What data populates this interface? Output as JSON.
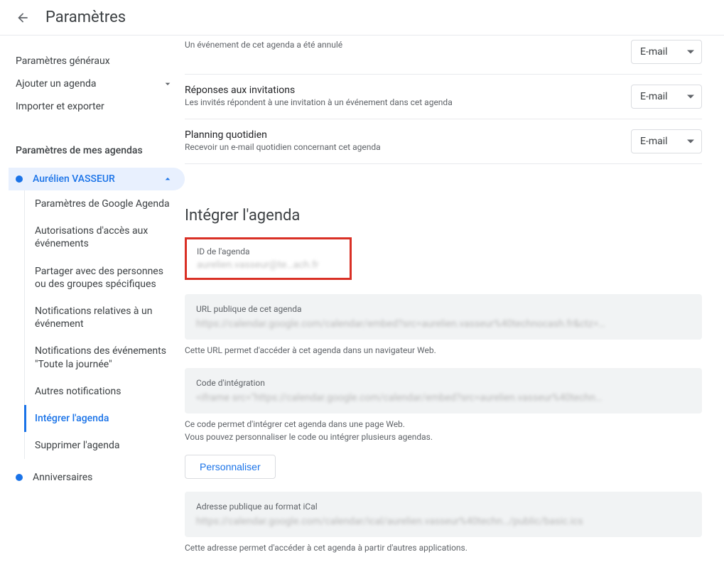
{
  "header": {
    "title": "Paramètres"
  },
  "sidebar": {
    "generalItems": [
      {
        "label": "Paramètres généraux",
        "expandable": false
      },
      {
        "label": "Ajouter un agenda",
        "expandable": true
      },
      {
        "label": "Importer et exporter",
        "expandable": false
      }
    ],
    "myCalsHeader": "Paramètres de mes agendas",
    "activeCalendar": {
      "name": "Aurélien VASSEUR",
      "color": "#1a73e8"
    },
    "subitems": [
      "Paramètres de Google Agenda",
      "Autorisations d'accès aux événements",
      "Partager avec des personnes ou des groupes spécifiques",
      "Notifications relatives à un événement",
      "Notifications des événements \"Toute la journée\"",
      "Autres notifications",
      "Intégrer l'agenda",
      "Supprimer l'agenda"
    ],
    "activeSubIndex": 6,
    "otherCalendar": {
      "name": "Anniversaires",
      "color": "#1a73e8"
    }
  },
  "notifications": {
    "cancelled": {
      "desc": "Un événement de cet agenda a été annulé",
      "value": "E-mail"
    },
    "inviteReplies": {
      "title": "Réponses aux invitations",
      "desc": "Les invités répondent à une invitation à un événement dans cet agenda",
      "value": "E-mail"
    },
    "daily": {
      "title": "Planning quotidien",
      "desc": "Recevoir un e-mail quotidien concernant cet agenda",
      "value": "E-mail"
    }
  },
  "integrate": {
    "sectionTitle": "Intégrer l'agenda",
    "calendarId": {
      "label": "ID de l'agenda",
      "value": "aurelien.vasseur@te…ach.fr"
    },
    "publicUrl": {
      "label": "URL publique de cet agenda",
      "value": "https://calendar.google.com/calendar/embed?src=aurelien.vasseur%40technocash.fr&ctz=…",
      "helper": "Cette URL permet d'accéder à cet agenda dans un navigateur Web."
    },
    "embedCode": {
      "label": "Code d'intégration",
      "value": "<iframe src=\"https://calendar.google.com/calendar/embed?src=aurelien.vasseur%40techn…",
      "helper1": "Ce code permet d'intégrer cet agenda dans une page Web.",
      "helper2": "Vous pouvez personnaliser le code ou intégrer plusieurs agendas."
    },
    "customizeBtn": "Personnaliser",
    "ical": {
      "label": "Adresse publique au format iCal",
      "value": "https://calendar.google.com/calendar/ical/aurelien.vasseur%40techn…/public/basic.ics",
      "helper": "Cette adresse permet d'accéder à cet agenda à partir d'autres applications."
    }
  }
}
